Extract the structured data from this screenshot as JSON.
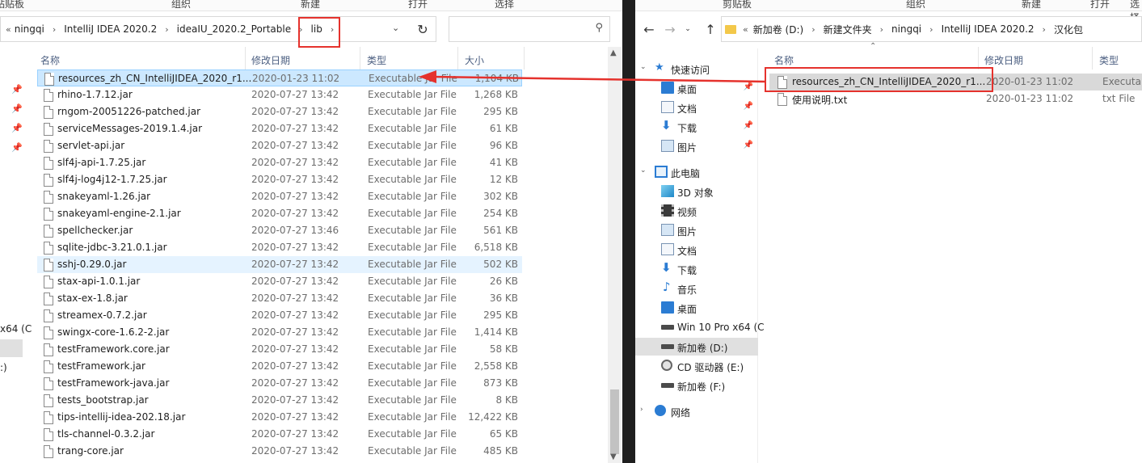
{
  "left": {
    "ribbon": [
      "粘贴板",
      "组织",
      "新建",
      "打开",
      "选择"
    ],
    "breadcrumbs": [
      "ningqi",
      "IntelliJ IDEA 2020.2",
      "ideaIU_2020.2_Portable",
      "lib"
    ],
    "columns": {
      "name": "名称",
      "date": "修改日期",
      "type": "类型",
      "size": "大小"
    },
    "files": [
      {
        "name": "resources_zh_CN_IntelliJIDEA_2020_r1...",
        "date": "2020-01-23 11:02",
        "type": "Executable Jar File",
        "size": "1,104 KB"
      },
      {
        "name": "rhino-1.7.12.jar",
        "date": "2020-07-27 13:42",
        "type": "Executable Jar File",
        "size": "1,268 KB"
      },
      {
        "name": "rngom-20051226-patched.jar",
        "date": "2020-07-27 13:42",
        "type": "Executable Jar File",
        "size": "295 KB"
      },
      {
        "name": "serviceMessages-2019.1.4.jar",
        "date": "2020-07-27 13:42",
        "type": "Executable Jar File",
        "size": "61 KB"
      },
      {
        "name": "servlet-api.jar",
        "date": "2020-07-27 13:42",
        "type": "Executable Jar File",
        "size": "96 KB"
      },
      {
        "name": "slf4j-api-1.7.25.jar",
        "date": "2020-07-27 13:42",
        "type": "Executable Jar File",
        "size": "41 KB"
      },
      {
        "name": "slf4j-log4j12-1.7.25.jar",
        "date": "2020-07-27 13:42",
        "type": "Executable Jar File",
        "size": "12 KB"
      },
      {
        "name": "snakeyaml-1.26.jar",
        "date": "2020-07-27 13:42",
        "type": "Executable Jar File",
        "size": "302 KB"
      },
      {
        "name": "snakeyaml-engine-2.1.jar",
        "date": "2020-07-27 13:42",
        "type": "Executable Jar File",
        "size": "254 KB"
      },
      {
        "name": "spellchecker.jar",
        "date": "2020-07-27 13:46",
        "type": "Executable Jar File",
        "size": "561 KB"
      },
      {
        "name": "sqlite-jdbc-3.21.0.1.jar",
        "date": "2020-07-27 13:42",
        "type": "Executable Jar File",
        "size": "6,518 KB"
      },
      {
        "name": "sshj-0.29.0.jar",
        "date": "2020-07-27 13:42",
        "type": "Executable Jar File",
        "size": "502 KB"
      },
      {
        "name": "stax-api-1.0.1.jar",
        "date": "2020-07-27 13:42",
        "type": "Executable Jar File",
        "size": "26 KB"
      },
      {
        "name": "stax-ex-1.8.jar",
        "date": "2020-07-27 13:42",
        "type": "Executable Jar File",
        "size": "36 KB"
      },
      {
        "name": "streamex-0.7.2.jar",
        "date": "2020-07-27 13:42",
        "type": "Executable Jar File",
        "size": "295 KB"
      },
      {
        "name": "swingx-core-1.6.2-2.jar",
        "date": "2020-07-27 13:42",
        "type": "Executable Jar File",
        "size": "1,414 KB"
      },
      {
        "name": "testFramework.core.jar",
        "date": "2020-07-27 13:42",
        "type": "Executable Jar File",
        "size": "58 KB"
      },
      {
        "name": "testFramework.jar",
        "date": "2020-07-27 13:42",
        "type": "Executable Jar File",
        "size": "2,558 KB"
      },
      {
        "name": "testFramework-java.jar",
        "date": "2020-07-27 13:42",
        "type": "Executable Jar File",
        "size": "873 KB"
      },
      {
        "name": "tests_bootstrap.jar",
        "date": "2020-07-27 13:42",
        "type": "Executable Jar File",
        "size": "8 KB"
      },
      {
        "name": "tips-intellij-idea-202.18.jar",
        "date": "2020-07-27 13:42",
        "type": "Executable Jar File",
        "size": "12,422 KB"
      },
      {
        "name": "tls-channel-0.3.2.jar",
        "date": "2020-07-27 13:42",
        "type": "Executable Jar File",
        "size": "65 KB"
      },
      {
        "name": "trang-core.jar",
        "date": "2020-07-27 13:42",
        "type": "Executable Jar File",
        "size": "485 KB"
      }
    ],
    "nav_sliver": {
      "drive_fragment": "x64 (C",
      "colon_fragment": ":)"
    }
  },
  "right": {
    "ribbon": [
      "剪贴板",
      "组织",
      "新建",
      "打开",
      "选择"
    ],
    "breadcrumbs": [
      "新加卷 (D:)",
      "新建文件夹",
      "ningqi",
      "IntelliJ IDEA 2020.2",
      "汉化包"
    ],
    "columns": {
      "name": "名称",
      "date": "修改日期",
      "type": "类型"
    },
    "files": [
      {
        "name": "resources_zh_CN_IntelliJIDEA_2020_r1...",
        "date": "2020-01-23 11:02",
        "type": "Executab"
      },
      {
        "name": "使用说明.txt",
        "date": "2020-01-23 11:02",
        "type": "txt File"
      }
    ],
    "nav": {
      "quick_access": "快速访问",
      "quick_items": [
        "桌面",
        "文档",
        "下载",
        "图片"
      ],
      "this_pc": "此电脑",
      "pc_items": [
        "3D 对象",
        "视频",
        "图片",
        "文档",
        "下载",
        "音乐",
        "桌面",
        "Win 10 Pro x64 (C",
        "新加卷 (D:)",
        "CD 驱动器 (E:)",
        "新加卷 (F:)"
      ],
      "network": "网络"
    }
  }
}
